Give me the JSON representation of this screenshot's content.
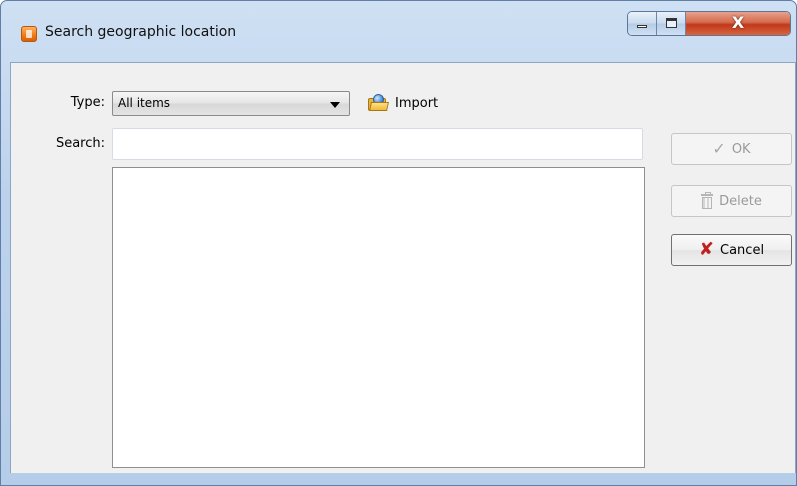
{
  "window": {
    "title": "Search geographic location",
    "icon": "search-location-app-icon",
    "controls": {
      "minimize": "minimize-icon",
      "maximize": "maximize-icon",
      "close_glyph": "X"
    }
  },
  "form": {
    "type_label": "Type:",
    "type_value": "All items",
    "import_label": "Import",
    "search_label": "Search:",
    "search_value": "",
    "search_placeholder": ""
  },
  "list": {
    "items": []
  },
  "buttons": {
    "ok": {
      "label": "OK",
      "icon": "check-icon",
      "enabled": false
    },
    "delete": {
      "label": "Delete",
      "icon": "trash-icon",
      "enabled": false
    },
    "cancel": {
      "label": "Cancel",
      "icon": "red-x-icon",
      "enabled": true
    }
  },
  "colors": {
    "frame": "#bcd2ec",
    "client": "#f0f0f0",
    "close_button": "#c0391b",
    "cancel_icon": "#c0211d"
  }
}
